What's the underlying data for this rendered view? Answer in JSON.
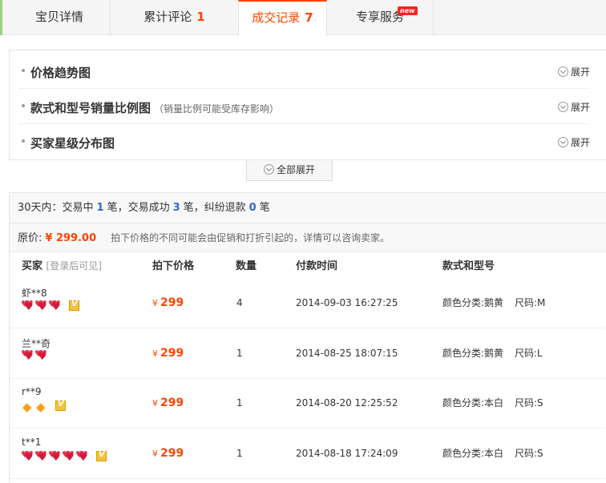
{
  "tabs": [
    {
      "label": "宝贝详情",
      "count": ""
    },
    {
      "label": "累计评论",
      "count": "1"
    },
    {
      "label": "成交记录",
      "count": "7"
    },
    {
      "label": "专享服务",
      "count": ""
    }
  ],
  "new_badge": "new",
  "charts": [
    {
      "title": "价格趋势图",
      "note": "",
      "expand": "展开"
    },
    {
      "title": "款式和型号销量比例图",
      "note": "（销量比例可能受库存影响）",
      "expand": "展开"
    },
    {
      "title": "买家星级分布图",
      "note": "",
      "expand": "展开"
    }
  ],
  "expand_all": "全部展开",
  "summary": {
    "prefix": "30天内：交易中",
    "trading": "1",
    "mid1": "笔，交易成功",
    "success": "3",
    "mid2": "笔，纠纷退款",
    "refund": "0",
    "suffix": "笔"
  },
  "original_price": {
    "label": "原价:",
    "value": "¥ 299.00",
    "tip": "拍下价格的不同可能会由促销和打折引起的，详情可以咨询卖家。"
  },
  "columns": {
    "buyer": "买家",
    "buyer_sub": "[登录后可见]",
    "price": "拍下价格",
    "qty": "数量",
    "time": "付款时间",
    "spec": "款式和型号"
  },
  "records": [
    {
      "buyer": "虾**8",
      "level_icon": "heart",
      "level_count": 3,
      "vip": true,
      "yen": "¥",
      "price": "299",
      "qty": "4",
      "time": "2014-09-03 16:27:25",
      "color": "颜色分类:鹅黄",
      "size": "尺码:M"
    },
    {
      "buyer": "兰**奇",
      "level_icon": "heart",
      "level_count": 2,
      "vip": false,
      "yen": "¥",
      "price": "299",
      "qty": "1",
      "time": "2014-08-25 18:07:15",
      "color": "颜色分类:鹅黄",
      "size": "尺码:L"
    },
    {
      "buyer": "r**9",
      "level_icon": "diamond",
      "level_count": 2,
      "vip": true,
      "yen": "¥",
      "price": "299",
      "qty": "1",
      "time": "2014-08-20 12:25:52",
      "color": "颜色分类:本白",
      "size": "尺码:S"
    },
    {
      "buyer": "t**1",
      "level_icon": "heart",
      "level_count": 5,
      "vip": true,
      "yen": "¥",
      "price": "299",
      "qty": "1",
      "time": "2014-08-18 17:24:09",
      "color": "颜色分类:本白",
      "size": "尺码:S"
    }
  ]
}
